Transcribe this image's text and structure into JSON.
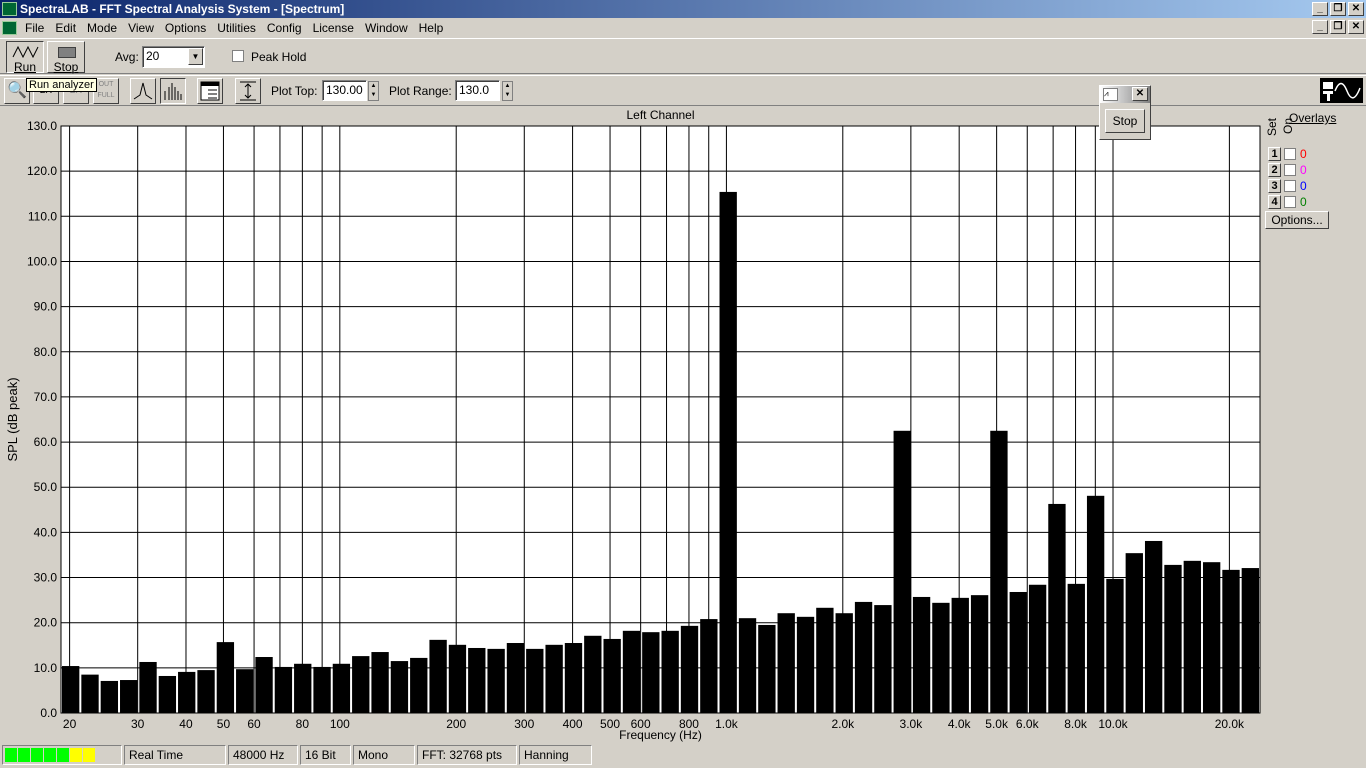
{
  "window": {
    "title": "SpectraLAB - FFT Spectral Analysis System - [Spectrum]"
  },
  "menu": [
    "File",
    "Edit",
    "Mode",
    "View",
    "Options",
    "Utilities",
    "Config",
    "License",
    "Window",
    "Help"
  ],
  "toolbar": {
    "run_label": "Run",
    "stop_label": "Stop",
    "avg_label": "Avg:",
    "avg_value": "20",
    "peak_hold_label": "Peak Hold",
    "peak_hold_checked": false,
    "tooltip": "Run analyzer",
    "zoom_in": "2X",
    "zoom_out": "2X",
    "zoom_full": "OUT FULL",
    "plot_top_label": "Plot Top:",
    "plot_top_value": "130.00",
    "plot_range_label": "Plot Range:",
    "plot_range_value": "130.0"
  },
  "mini_window": {
    "stop_label": "Stop"
  },
  "overlays": {
    "title": "Overlays",
    "set_label": "Set",
    "on_label": "On",
    "options_label": "Options...",
    "items": [
      {
        "set": "1",
        "count": "0",
        "color": "#ff0000"
      },
      {
        "set": "2",
        "count": "0",
        "color": "#ff00ff"
      },
      {
        "set": "3",
        "count": "0",
        "color": "#0000ff"
      },
      {
        "set": "4",
        "count": "0",
        "color": "#008000"
      }
    ]
  },
  "status": {
    "level_leds": [
      "#00ff00",
      "#00ff00",
      "#00ff00",
      "#00ff00",
      "#00ff00",
      "#ffff00",
      "#ffff00"
    ],
    "mode": "Real Time",
    "rate": "48000 Hz",
    "bits": "16 Bit",
    "channels": "Mono",
    "fft": "FFT: 32768 pts",
    "window": "Hanning"
  },
  "chart_data": {
    "type": "bar",
    "title": "Left Channel",
    "xlabel": "Frequency (Hz)",
    "ylabel": "SPL (dB peak)",
    "xscale": "log",
    "xlim": [
      19,
      24000
    ],
    "ylim": [
      0,
      130
    ],
    "grid": true,
    "bar_color": "#000000",
    "yticks": [
      "0.0",
      "10.0",
      "20.0",
      "30.0",
      "40.0",
      "50.0",
      "60.0",
      "70.0",
      "80.0",
      "90.0",
      "100.0",
      "110.0",
      "120.0",
      "130.0"
    ],
    "xticks": [
      {
        "v": 20,
        "l": "20"
      },
      {
        "v": 30,
        "l": "30"
      },
      {
        "v": 40,
        "l": "40"
      },
      {
        "v": 50,
        "l": "50"
      },
      {
        "v": 60,
        "l": "60"
      },
      {
        "v": 80,
        "l": "80"
      },
      {
        "v": 100,
        "l": "100"
      },
      {
        "v": 200,
        "l": "200"
      },
      {
        "v": 300,
        "l": "300"
      },
      {
        "v": 400,
        "l": "400"
      },
      {
        "v": 500,
        "l": "500"
      },
      {
        "v": 600,
        "l": "600"
      },
      {
        "v": 800,
        "l": "800"
      },
      {
        "v": 1000,
        "l": "1.0k"
      },
      {
        "v": 2000,
        "l": "2.0k"
      },
      {
        "v": 3000,
        "l": "3.0k"
      },
      {
        "v": 4000,
        "l": "4.0k"
      },
      {
        "v": 5000,
        "l": "5.0k"
      },
      {
        "v": 6000,
        "l": "6.0k"
      },
      {
        "v": 8000,
        "l": "8.0k"
      },
      {
        "v": 10000,
        "l": "10.0k"
      },
      {
        "v": 20000,
        "l": "20.0k"
      }
    ],
    "gridx": [
      20,
      30,
      40,
      50,
      60,
      70,
      80,
      90,
      100,
      200,
      300,
      400,
      500,
      600,
      700,
      800,
      900,
      1000,
      2000,
      3000,
      4000,
      5000,
      6000,
      7000,
      8000,
      9000,
      10000,
      20000
    ],
    "values": [
      10.4,
      8.5,
      7.1,
      7.3,
      11.3,
      8.2,
      9.1,
      9.5,
      15.7,
      9.7,
      12.4,
      10.2,
      10.9,
      10.2,
      10.9,
      12.6,
      13.5,
      11.5,
      12.2,
      16.2,
      15.1,
      14.4,
      14.2,
      15.5,
      14.2,
      15.1,
      15.5,
      17.1,
      16.4,
      18.2,
      17.9,
      18.2,
      19.3,
      20.8,
      115.4,
      21.0,
      19.5,
      22.1,
      21.3,
      23.3,
      22.1,
      24.6,
      23.9,
      62.5,
      25.7,
      24.4,
      25.5,
      26.1,
      62.5,
      26.8,
      28.4,
      46.3,
      28.6,
      48.1,
      29.7,
      35.4,
      38.1,
      32.8,
      33.7,
      33.4,
      31.7,
      32.1
    ]
  }
}
